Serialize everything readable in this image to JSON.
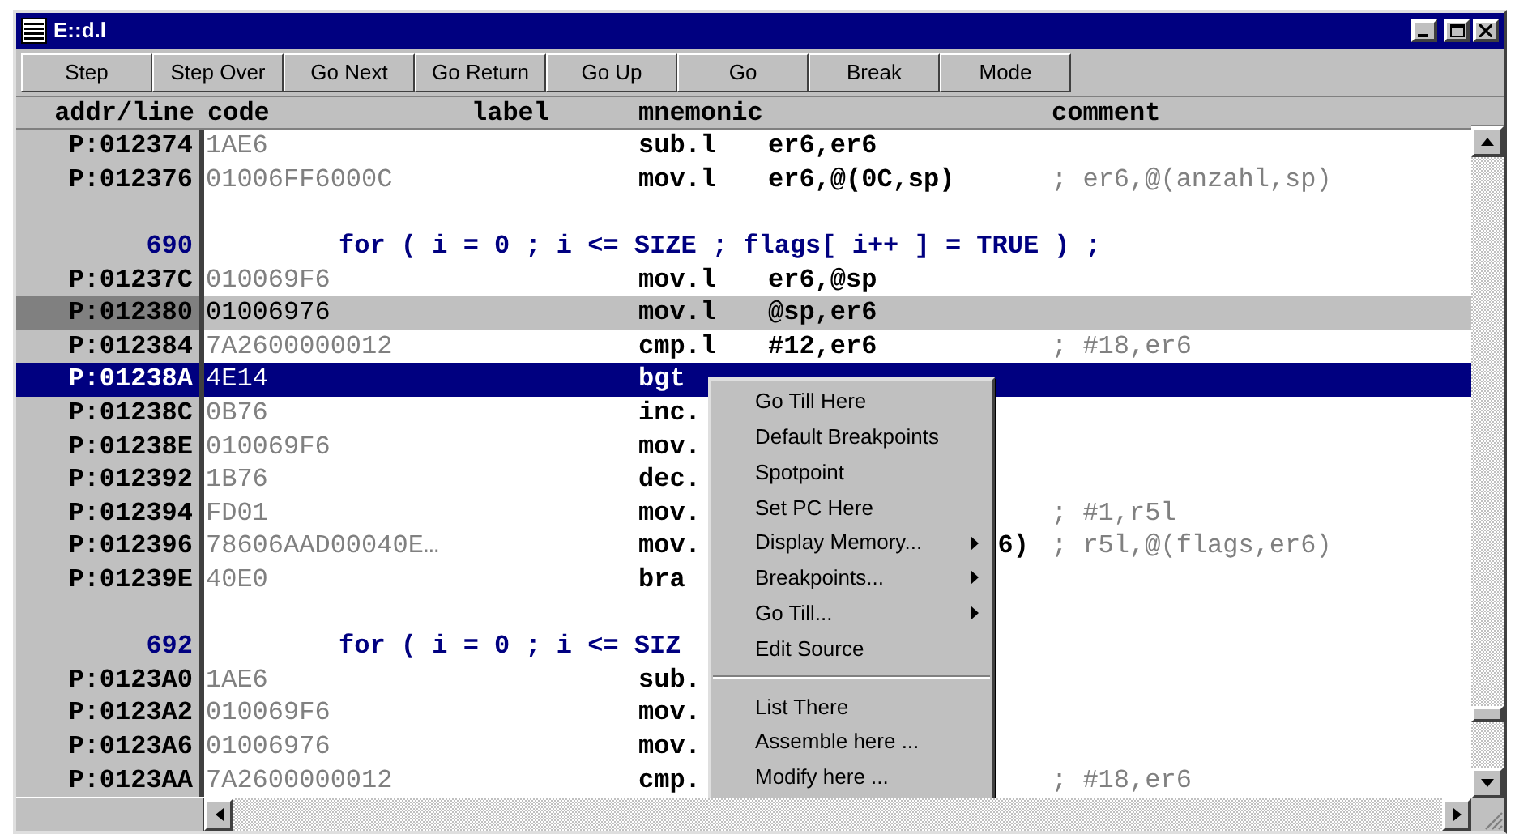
{
  "window": {
    "title": "E::d.l"
  },
  "toolbar": [
    "Step",
    "Step Over",
    "Go Next",
    "Go Return",
    "Go Up",
    "Go",
    "Break",
    "Mode"
  ],
  "columns": [
    "addr/line",
    "code",
    "label",
    "mnemonic",
    "comment"
  ],
  "rows": [
    {
      "kind": "instr",
      "addr": "P:012374",
      "code": "1AE6",
      "mnemonic": "sub.l",
      "operand": "er6,er6",
      "selected": false,
      "marked": false
    },
    {
      "kind": "instr",
      "addr": "P:012376",
      "code": "01006FF6000C",
      "mnemonic": "mov.l",
      "operand": "er6,@(0C,sp)",
      "comment": "; er6,@(anzahl,sp)",
      "selected": false,
      "marked": false
    },
    {
      "kind": "blank"
    },
    {
      "kind": "source",
      "line": "690",
      "text": "for ( i = 0 ; i <= SIZE ; flags[ i++ ] = TRUE ) ;"
    },
    {
      "kind": "instr",
      "addr": "P:01237C",
      "code": "010069F6",
      "mnemonic": "mov.l",
      "operand": "er6,@sp",
      "selected": false,
      "marked": false
    },
    {
      "kind": "instr",
      "addr": "P:012380",
      "code": "01006976",
      "mnemonic": "mov.l",
      "operand": "@sp,er6",
      "selected": false,
      "marked": true
    },
    {
      "kind": "instr",
      "addr": "P:012384",
      "code": "7A2600000012",
      "mnemonic": "cmp.l",
      "operand": "#12,er6",
      "comment": "; #18,er6",
      "selected": false,
      "marked": false
    },
    {
      "kind": "instr",
      "addr": "P:01238A",
      "code": "4E14",
      "mnemonic": "bgt",
      "selected": true,
      "marked": false
    },
    {
      "kind": "instr",
      "addr": "P:01238C",
      "code": "0B76",
      "mnemonic": "inc.",
      "selected": false,
      "marked": false
    },
    {
      "kind": "instr",
      "addr": "P:01238E",
      "code": "010069F6",
      "mnemonic": "mov.",
      "selected": false,
      "marked": false
    },
    {
      "kind": "instr",
      "addr": "P:012392",
      "code": "1B76",
      "mnemonic": "dec.",
      "selected": false,
      "marked": false
    },
    {
      "kind": "instr",
      "addr": "P:012394",
      "code": "FD01",
      "mnemonic": "mov.",
      "comment": "; #1,r5l",
      "selected": false,
      "marked": false
    },
    {
      "kind": "instr",
      "addr": "P:012396",
      "code": "78606AAD00040E…",
      "mnemonic": "mov.",
      "operand": "6)",
      "comment": "; r5l,@(flags,er6)",
      "selected": false,
      "marked": false,
      "clipped": true
    },
    {
      "kind": "instr",
      "addr": "P:01239E",
      "code": "40E0",
      "mnemonic": "bra",
      "selected": false,
      "marked": false
    },
    {
      "kind": "blank"
    },
    {
      "kind": "source",
      "line": "692",
      "text": "for ( i = 0 ; i <= SIZ"
    },
    {
      "kind": "instr",
      "addr": "P:0123A0",
      "code": "1AE6",
      "mnemonic": "sub.",
      "selected": false,
      "marked": false
    },
    {
      "kind": "instr",
      "addr": "P:0123A2",
      "code": "010069F6",
      "mnemonic": "mov.",
      "selected": false,
      "marked": false
    },
    {
      "kind": "instr",
      "addr": "P:0123A6",
      "code": "01006976",
      "mnemonic": "mov.",
      "selected": false,
      "marked": false
    },
    {
      "kind": "instr",
      "addr": "P:0123AA",
      "code": "7A2600000012",
      "mnemonic": "cmp.",
      "comment": "; #18,er6",
      "selected": false,
      "marked": false
    }
  ],
  "context_menu": [
    {
      "kind": "item",
      "label": "Go Till Here",
      "submenu": false
    },
    {
      "kind": "item",
      "label": "Default Breakpoints",
      "submenu": false
    },
    {
      "kind": "item",
      "label": "Spotpoint",
      "submenu": false
    },
    {
      "kind": "item",
      "label": "Set PC Here",
      "submenu": false
    },
    {
      "kind": "item",
      "label": "Display Memory...",
      "submenu": true
    },
    {
      "kind": "item",
      "label": "Breakpoints...",
      "submenu": true
    },
    {
      "kind": "item",
      "label": "Go Till...",
      "submenu": true
    },
    {
      "kind": "item",
      "label": "Edit Source",
      "submenu": false
    },
    {
      "kind": "separator"
    },
    {
      "kind": "item",
      "label": "List There",
      "submenu": false
    },
    {
      "kind": "item",
      "label": "Assemble here ...",
      "submenu": false
    },
    {
      "kind": "item",
      "label": "Modify here ...",
      "submenu": false
    }
  ]
}
